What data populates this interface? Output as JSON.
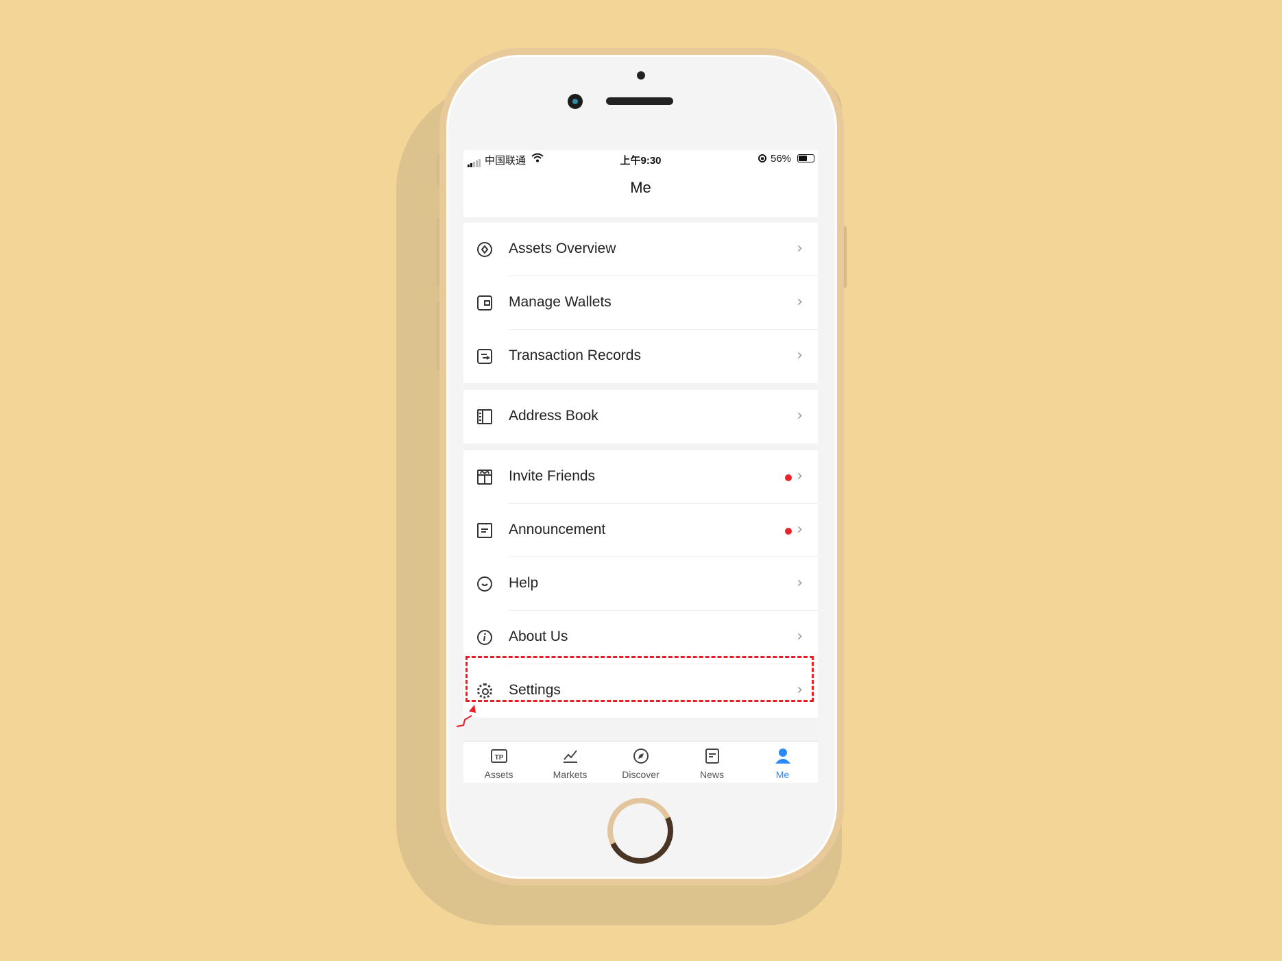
{
  "status_bar": {
    "carrier": "中国联通",
    "time": "上午9:30",
    "battery": "56%"
  },
  "header": {
    "title": "Me"
  },
  "menu": {
    "assets_overview": "Assets Overview",
    "manage_wallets": "Manage Wallets",
    "transaction_records": "Transaction Records",
    "address_book": "Address Book",
    "invite_friends": "Invite Friends",
    "announcement": "Announcement",
    "help": "Help",
    "about_us": "About Us",
    "settings": "Settings"
  },
  "icons": {
    "assets_overview": "circle-diamond-icon",
    "manage_wallets": "wallet-icon",
    "transaction_records": "records-icon",
    "address_book": "book-icon",
    "invite_friends": "gift-icon",
    "announcement": "announcement-icon",
    "help": "help-chat-icon",
    "about_us": "info-icon",
    "settings": "gear-icon"
  },
  "tabs": {
    "assets": "Assets",
    "markets": "Markets",
    "discover": "Discover",
    "news": "News",
    "me": "Me",
    "active": "Me"
  },
  "colors": {
    "background": "#f2d597",
    "accent": "#2a8af6",
    "badge": "#e8242a",
    "highlight": "#e81e25"
  }
}
